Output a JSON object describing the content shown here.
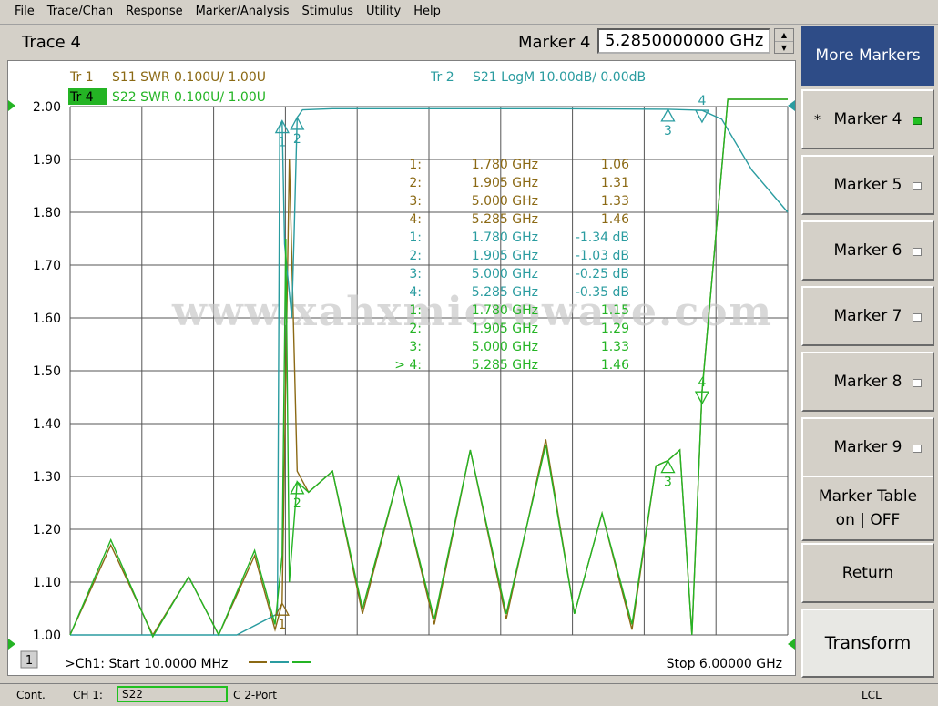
{
  "menu": [
    "File",
    "Trace/Chan",
    "Response",
    "Marker/Analysis",
    "Stimulus",
    "Utility",
    "Help"
  ],
  "header": {
    "trace_title": "Trace 4",
    "marker_label": "Marker 4",
    "marker_value": "5.2850000000 GHz"
  },
  "traces": {
    "tr1": {
      "id": "Tr  1",
      "text": "S11 SWR 0.100U/  1.00U",
      "color": "#8b6914"
    },
    "tr2": {
      "id": "Tr  2",
      "text": "S21 LogM 10.00dB/  0.00dB",
      "color": "#2a9ca0"
    },
    "tr4": {
      "id": "Tr  4",
      "text": "S22 SWR 0.100U/  1.00U",
      "color": "#24b424"
    }
  },
  "chart_data": {
    "type": "line",
    "x_range_ghz": [
      0.01,
      6.0
    ],
    "ylim": [
      1.0,
      2.0
    ],
    "y_ticks": [
      "2.00",
      "1.90",
      "1.80",
      "1.70",
      "1.60",
      "1.50",
      "1.40",
      "1.30",
      "1.20",
      "1.10",
      "1.00"
    ],
    "start_label": ">Ch1: Start  10.0000 MHz",
    "stop_label": "Stop  6.00000 GHz",
    "channel_badge": "1",
    "watermark": "www.xahxmicrowave.com",
    "series": [
      {
        "trace": "S11",
        "color": "#8b6914",
        "x": [
          0.01,
          0.35,
          0.7,
          1.0,
          1.25,
          1.55,
          1.72,
          1.78,
          1.84,
          1.905,
          2.0,
          2.2,
          2.45,
          2.75,
          3.05,
          3.35,
          3.65,
          3.98,
          4.22,
          4.45,
          4.7,
          4.9,
          5.0,
          5.1,
          5.2,
          5.285,
          5.5,
          6.0
        ],
        "y": [
          1.0,
          1.17,
          1.0,
          1.11,
          1.0,
          1.15,
          1.01,
          1.06,
          1.9,
          1.31,
          1.27,
          1.31,
          1.04,
          1.3,
          1.02,
          1.35,
          1.03,
          1.37,
          1.04,
          1.23,
          1.01,
          1.32,
          1.33,
          1.35,
          1.0,
          1.46,
          2.05,
          2.05
        ]
      },
      {
        "trace": "S21 (dB)",
        "color": "#2a9ca0",
        "x": [
          0.01,
          1.4,
          1.74,
          1.76,
          1.78,
          1.8,
          1.86,
          1.88,
          1.905,
          1.95,
          2.2,
          3.0,
          4.0,
          5.0,
          5.285,
          5.45,
          5.7,
          6.0
        ],
        "y": [
          -50.0,
          -50.0,
          -48.0,
          -2.0,
          -1.34,
          -13.0,
          -20.0,
          -12.0,
          -1.03,
          -0.3,
          -0.2,
          -0.2,
          -0.2,
          -0.25,
          -0.35,
          -1.2,
          -6.0,
          -10.0
        ]
      },
      {
        "trace": "S22",
        "color": "#24b424",
        "x": [
          0.01,
          0.35,
          0.7,
          1.0,
          1.25,
          1.55,
          1.72,
          1.78,
          1.81,
          1.84,
          1.905,
          2.0,
          2.2,
          2.45,
          2.75,
          3.05,
          3.35,
          3.65,
          3.98,
          4.22,
          4.45,
          4.7,
          4.9,
          5.0,
          5.1,
          5.2,
          5.285,
          5.5,
          6.0
        ],
        "y": [
          1.0,
          1.18,
          0.99,
          1.11,
          1.0,
          1.16,
          1.02,
          1.15,
          1.75,
          1.1,
          1.29,
          1.27,
          1.31,
          1.05,
          1.3,
          1.03,
          1.35,
          1.04,
          1.36,
          1.04,
          1.23,
          1.02,
          1.32,
          1.33,
          1.35,
          1.0,
          1.46,
          2.02,
          2.02
        ]
      }
    ],
    "marker_table": [
      {
        "n": "1:",
        "f": "1.780 GHz",
        "v": "1.06",
        "color": "#8b6914"
      },
      {
        "n": "2:",
        "f": "1.905 GHz",
        "v": "1.31",
        "color": "#8b6914"
      },
      {
        "n": "3:",
        "f": "5.000 GHz",
        "v": "1.33",
        "color": "#8b6914"
      },
      {
        "n": "4:",
        "f": "5.285 GHz",
        "v": "1.46",
        "color": "#8b6914"
      },
      {
        "n": "1:",
        "f": "1.780 GHz",
        "v": "-1.34 dB",
        "color": "#2a9ca0"
      },
      {
        "n": "2:",
        "f": "1.905 GHz",
        "v": "-1.03 dB",
        "color": "#2a9ca0"
      },
      {
        "n": "3:",
        "f": "5.000 GHz",
        "v": "-0.25 dB",
        "color": "#2a9ca0"
      },
      {
        "n": "4:",
        "f": "5.285 GHz",
        "v": "-0.35 dB",
        "color": "#2a9ca0"
      },
      {
        "n": "1:",
        "f": "1.780 GHz",
        "v": "1.15",
        "color": "#24b424"
      },
      {
        "n": "2:",
        "f": "1.905 GHz",
        "v": "1.29",
        "color": "#24b424"
      },
      {
        "n": "3:",
        "f": "5.000 GHz",
        "v": "1.33",
        "color": "#24b424"
      },
      {
        "n": "> 4:",
        "f": "5.285 GHz",
        "v": "1.46",
        "color": "#24b424"
      }
    ],
    "markers": [
      {
        "label": "1",
        "trace": "S21",
        "x": 1.78,
        "color": "#2a9ca0"
      },
      {
        "label": "2",
        "trace": "S21",
        "x": 1.905,
        "color": "#2a9ca0"
      },
      {
        "label": "3",
        "trace": "S21",
        "x": 5.0,
        "color": "#2a9ca0"
      },
      {
        "label": "4",
        "trace": "S21",
        "x": 5.285,
        "color": "#2a9ca0"
      },
      {
        "label": "1",
        "trace": "S11",
        "x": 1.78,
        "color": "#8b6914"
      },
      {
        "label": "2",
        "trace": "S22",
        "x": 1.905,
        "color": "#24b424"
      },
      {
        "label": "3",
        "trace": "S22",
        "x": 5.0,
        "color": "#24b424"
      },
      {
        "label": "4",
        "trace": "S22",
        "x": 5.285,
        "color": "#24b424"
      }
    ]
  },
  "softkeys": {
    "more_markers": "More Markers",
    "marker4": "Marker 4",
    "marker5": "Marker 5",
    "marker6": "Marker 6",
    "marker7": "Marker 7",
    "marker8": "Marker 8",
    "marker9": "Marker 9",
    "marker_table_line1": "Marker Table",
    "marker_table_line2": "on | OFF",
    "return": "Return",
    "transform": "Transform"
  },
  "status": {
    "mode": "Cont.",
    "channel": "CH 1:",
    "param": "S22",
    "cal": "C  2-Port",
    "lcl": "LCL"
  }
}
